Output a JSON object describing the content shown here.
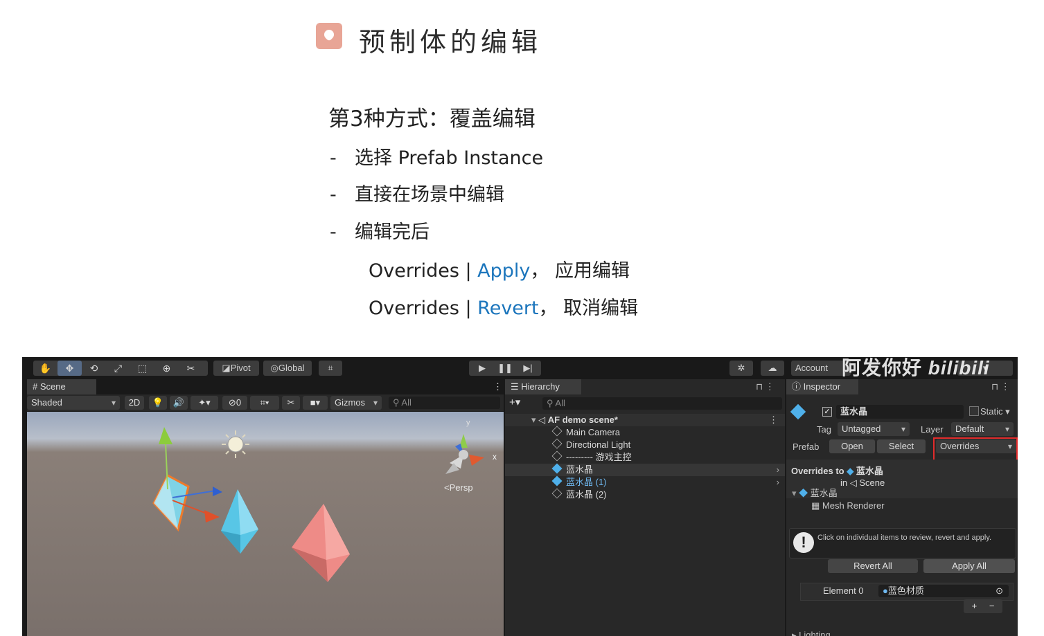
{
  "slide": {
    "title": "预制体的编辑",
    "subtitle": "第3种方式：覆盖编辑",
    "bullets": [
      "选择 Prefab Instance",
      "直接在场景中编辑",
      "编辑完后"
    ],
    "dash": "-",
    "overrides_apply": {
      "prefix": "Overrides | ",
      "action": "Apply",
      "suffix": "，  应用编辑"
    },
    "overrides_revert": {
      "prefix": "Overrides | ",
      "action": "Revert",
      "suffix": "，  取消编辑"
    },
    "accent_color": "#1b75bc",
    "icon_color": "#e8a596"
  },
  "editor": {
    "toolbar": {
      "pivot": "Pivot",
      "global": "Global",
      "account": "Account",
      "watermark": "阿发你好",
      "watermark_logo": "bilibili"
    },
    "scene": {
      "tab": "Scene",
      "shading": "Shaded",
      "mode_2d": "2D",
      "gizmos": "Gizmos",
      "layers_count": "0",
      "search_placeholder": "All",
      "persp_label": "<Persp",
      "axis_x": "x",
      "axis_y": "y"
    },
    "hierarchy": {
      "tab": "Hierarchy",
      "search_placeholder": "All",
      "scene_name": "AF demo scene*",
      "items": [
        {
          "name": "Main Camera",
          "prefab": false
        },
        {
          "name": "Directional Light",
          "prefab": false
        },
        {
          "name": "--------- 游戏主控",
          "prefab": false
        },
        {
          "name": "蓝水晶",
          "prefab": true,
          "selected": true
        },
        {
          "name": "蓝水晶 (1)",
          "prefab": true,
          "blue": true
        },
        {
          "name": "蓝水晶 (2)",
          "prefab": false
        }
      ]
    },
    "inspector": {
      "tab": "Inspector",
      "object_name": "蓝水晶",
      "static_label": "Static",
      "tag_label": "Tag",
      "tag_value": "Untagged",
      "layer_label": "Layer",
      "layer_value": "Default",
      "prefab_label": "Prefab",
      "open": "Open",
      "select": "Select",
      "overrides": "Overrides",
      "overrides_to": "Overrides to",
      "overrides_target": "蓝水晶",
      "in_label": "in",
      "in_scene": "Scene",
      "tree_root": "蓝水晶",
      "tree_child": "Mesh Renderer",
      "info_text": "Click on individual items to review, revert and apply.",
      "revert_all": "Revert All",
      "apply_all": "Apply All",
      "element_label": "Element 0",
      "element_value": "蓝色材质",
      "add": "+",
      "remove": "−",
      "truncated_next": "Lighting"
    }
  }
}
